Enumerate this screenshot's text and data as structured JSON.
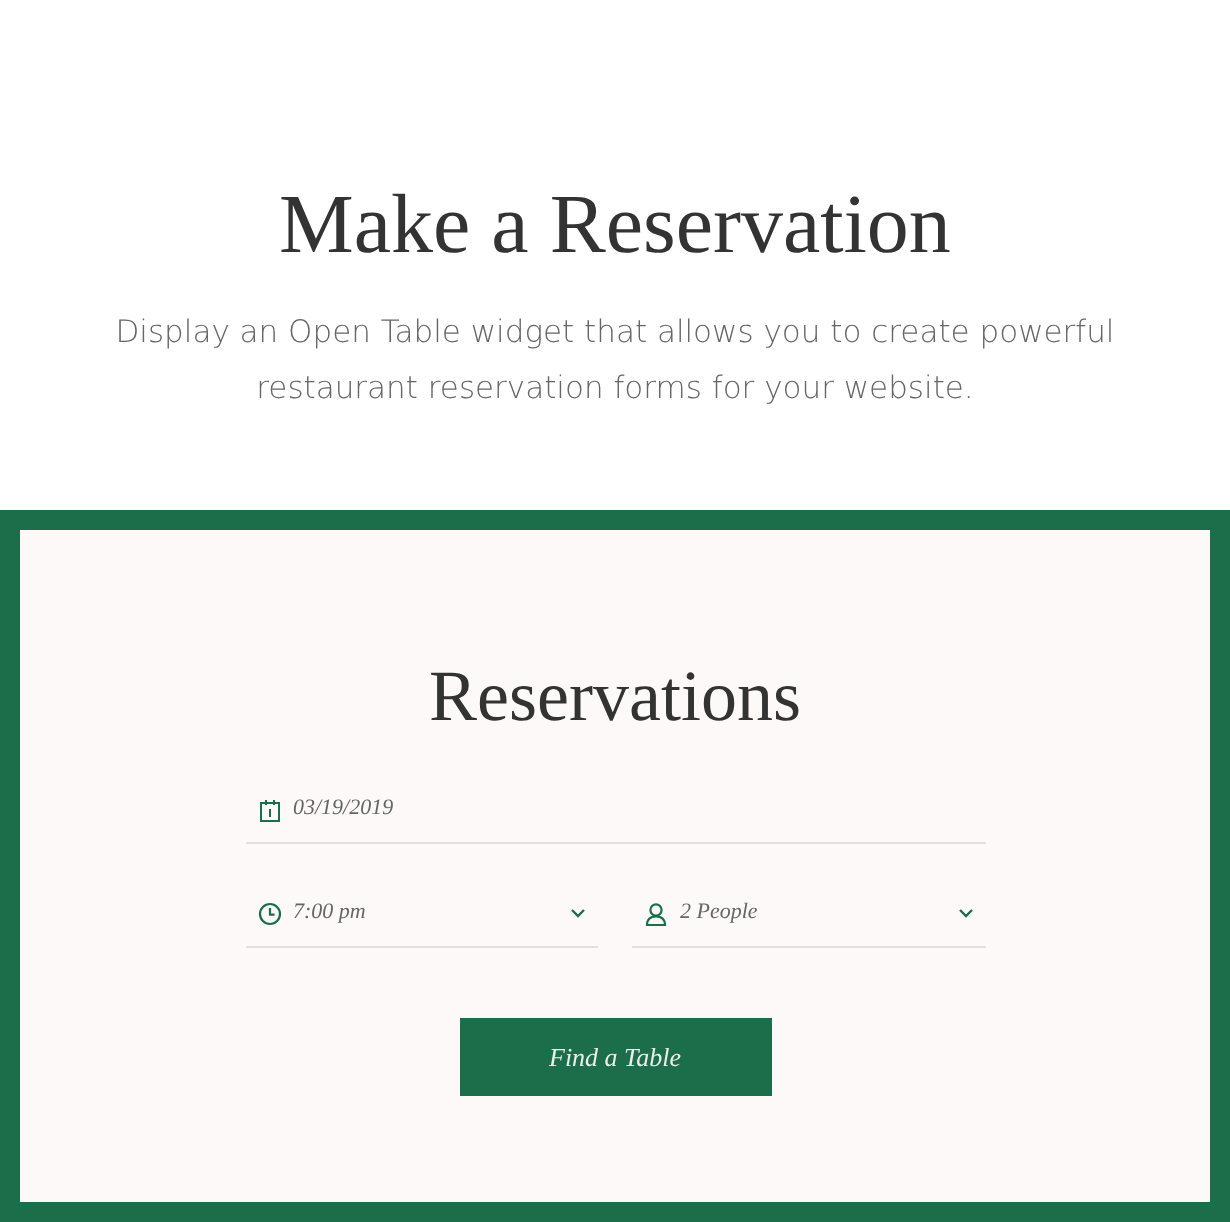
{
  "header": {
    "title": "Make a Reservation",
    "description": "Display an Open Table widget that allows you to create powerful restaurant reservation forms for your website."
  },
  "widget": {
    "title": "Reservations",
    "fields": [
      {
        "kind": "date",
        "value": "03/19/2019"
      },
      {
        "kind": "time",
        "value": "7:00 pm"
      },
      {
        "kind": "party",
        "value": "2 People"
      }
    ],
    "button": "Find a Table"
  }
}
